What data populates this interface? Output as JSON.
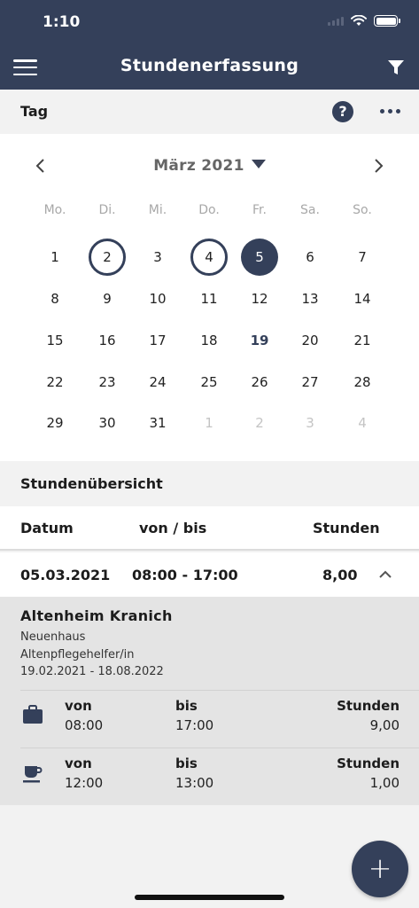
{
  "status_bar": {
    "time": "1:10"
  },
  "header": {
    "title": "Stundenerfassung"
  },
  "view": {
    "title": "Tag",
    "help_label": "?"
  },
  "calendar": {
    "month_label": "März 2021",
    "weekdays": [
      "Mo.",
      "Di.",
      "Mi.",
      "Do.",
      "Fr.",
      "Sa.",
      "So."
    ],
    "weeks": [
      [
        "1",
        "2",
        "3",
        "4",
        "5",
        "6",
        "7"
      ],
      [
        "8",
        "9",
        "10",
        "11",
        "12",
        "13",
        "14"
      ],
      [
        "15",
        "16",
        "17",
        "18",
        "19",
        "20",
        "21"
      ],
      [
        "22",
        "23",
        "24",
        "25",
        "26",
        "27",
        "28"
      ],
      [
        "29",
        "30",
        "31",
        "1",
        "2",
        "3",
        "4"
      ]
    ],
    "marked_days": [
      "2",
      "4"
    ],
    "selected_day": "5",
    "today": "19"
  },
  "overview": {
    "title": "Stundenübersicht",
    "columns": {
      "date": "Datum",
      "time": "von / bis",
      "hours": "Stunden"
    },
    "entry": {
      "date": "05.03.2021",
      "time": "08:00 - 17:00",
      "hours": "8,00",
      "expanded": true,
      "employer": "Altenheim Kranich",
      "location": "Neuenhaus",
      "role": "Altenpflegehelfer/in",
      "period": "19.02.2021 - 18.08.2022",
      "rows": [
        {
          "icon": "briefcase-icon",
          "from_label": "von",
          "from": "08:00",
          "to_label": "bis",
          "to": "17:00",
          "hours_label": "Stunden",
          "hours": "9,00"
        },
        {
          "icon": "coffee-cup-icon",
          "from_label": "von",
          "from": "12:00",
          "to_label": "bis",
          "to": "13:00",
          "hours_label": "Stunden",
          "hours": "1,00"
        }
      ]
    }
  },
  "fab": {
    "label": "+"
  },
  "colors": {
    "primary": "#34405a",
    "background": "#f2f2f2",
    "detail_bg": "#e4e4e4"
  }
}
